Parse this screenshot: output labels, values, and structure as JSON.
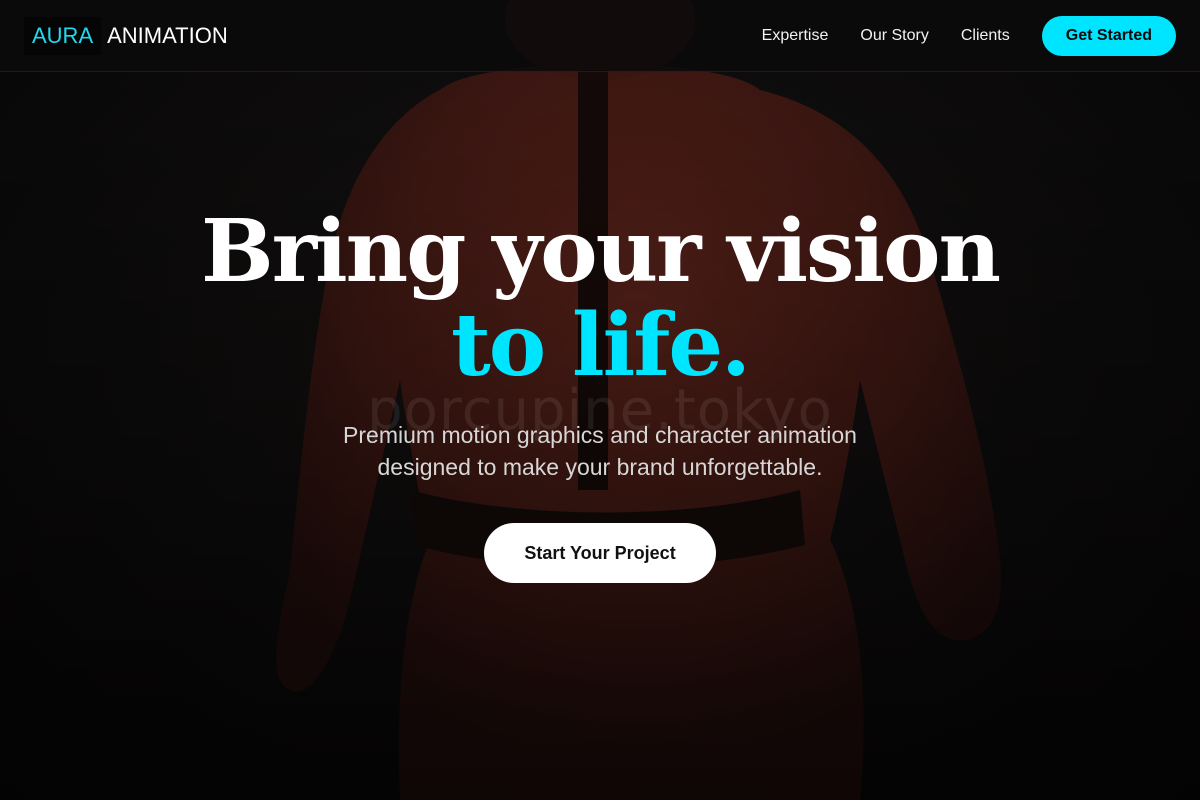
{
  "brand": {
    "accent_text": "AURA",
    "main_text": "ANIMATION"
  },
  "nav": {
    "links": [
      "Expertise",
      "Our Story",
      "Clients"
    ],
    "cta_label": "Get Started"
  },
  "hero": {
    "title_line1": "Bring your vision",
    "title_line2": "to life.",
    "subtitle_line1": "Premium motion graphics and character animation",
    "subtitle_line2": "designed to make your brand unforgettable.",
    "cta_label": "Start Your Project",
    "watermark": "porcupine.tokyo"
  },
  "colors": {
    "accent": "#00e5ff",
    "background": "#0d0c0c",
    "figure": "#7a2a1e"
  },
  "icons": {
    "background_figure": "character-figure-image"
  }
}
